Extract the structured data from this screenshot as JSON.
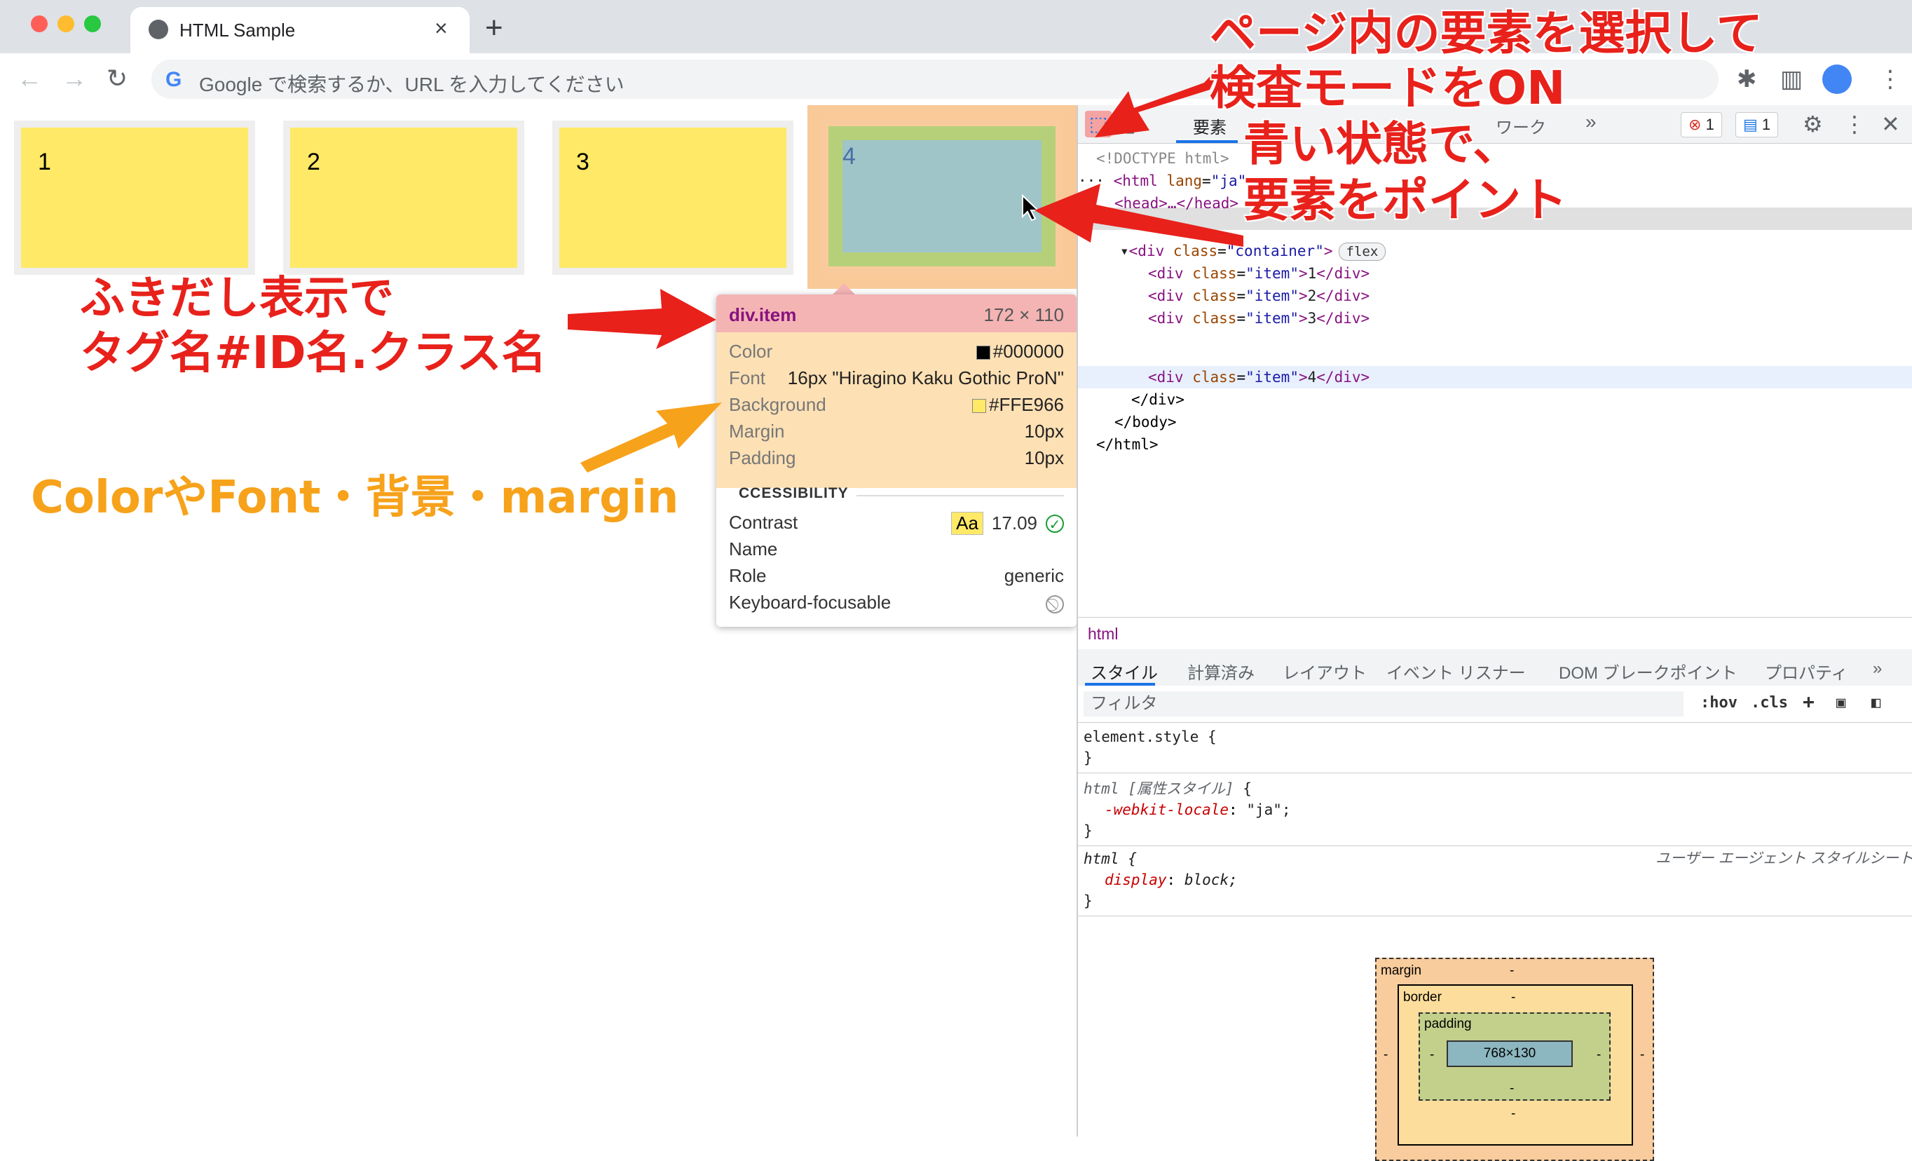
{
  "browser": {
    "tab_title": "HTML Sample",
    "tab_close": "×",
    "new_tab": "+",
    "omnibox_placeholder": "Google で検索するか、URL を入力してください",
    "back": "←",
    "forward": "→",
    "reload": "↻"
  },
  "page": {
    "items": [
      "1",
      "2",
      "3",
      "4"
    ]
  },
  "tooltip": {
    "tag": "div.item",
    "size": "172 × 110",
    "color_label": "Color",
    "color_value": "#000000",
    "font_label": "Font",
    "font_value": "16px \"Hiragino Kaku Gothic ProN\"",
    "background_label": "Background",
    "background_value": "#FFE966",
    "margin_label": "Margin",
    "margin_value": "10px",
    "padding_label": "Padding",
    "padding_value": "10px",
    "accessibility_heading": "CCESSIBILITY",
    "contrast_label": "Contrast",
    "contrast_aa": "Aa",
    "contrast_value": "17.09",
    "name_label": "Name",
    "role_label": "Role",
    "role_value": "generic",
    "keyboard_label": "Keyboard-focusable"
  },
  "devtools": {
    "elements_tab": "要素",
    "network_tab": "ワーク",
    "more_tabs": "»",
    "error_count": "1",
    "message_count": "1",
    "dom": {
      "doctype": "<!DOCTYPE html>",
      "html_open_tag": "<html",
      "html_attr": "lang",
      "html_attr_val": "\"ja\"",
      "html_close_bracket": ">",
      "head": "<head>…</head>",
      "div_open": "<div",
      "container_attr": "class",
      "container_val": "\"container\"",
      "flex_badge": "flex",
      "rows": [
        {
          "open": "<div",
          "attr": "class",
          "val": "\"item\"",
          "text": "1",
          "close": "</div>"
        },
        {
          "open": "<div",
          "attr": "class",
          "val": "\"item\"",
          "text": "2",
          "close": "</div>"
        },
        {
          "open": "<div",
          "attr": "class",
          "val": "\"item\"",
          "text": "3",
          "close": "</div>"
        },
        {
          "open": "<div",
          "attr": "class",
          "val": "\"item\"",
          "text": "4",
          "close": "</div>"
        }
      ],
      "div_close": "</div>",
      "body_close": "</body>",
      "html_close": "</html>"
    },
    "breadcrumb": "html",
    "style_tabs": [
      "スタイル",
      "計算済み",
      "レイアウト",
      "イベント リスナー",
      "DOM ブレークポイント",
      "プロパティ",
      "»"
    ],
    "filter_placeholder": "フィルタ",
    "hov": ":hov",
    "cls": ".cls",
    "styles": {
      "rule1_selector": "element.style {",
      "rule1_close": "}",
      "rule2_selector": "html",
      "rule2_attr": "[属性スタイル]",
      "rule2_brace": "{",
      "rule2_prop": "-webkit-locale",
      "rule2_val": "\"ja\";",
      "rule2_close": "}",
      "rule3_selector": "html {",
      "rule3_source": "ユーザー エージェント スタイルシート",
      "rule3_prop": "display",
      "rule3_val": "block;",
      "rule3_close": "}"
    },
    "box_model": {
      "margin_label": "margin",
      "border_label": "border",
      "padding_label": "padding",
      "content_size": "768×130",
      "dash": "-"
    }
  },
  "annotations": {
    "top_right_1": "ページ内の要素を選択して",
    "top_right_2": "検査モードをON",
    "top_right_3": "青い状態で、",
    "top_right_4": "要素をポイント",
    "left_1": "ふきだし表示で",
    "left_2": "タグ名#ID名.クラス名",
    "orange": "ColorやFont・背景・margin"
  },
  "colors": {
    "item_bg": "#FFE966",
    "annotation_red": "#E8211B",
    "annotation_orange": "#F7A21B",
    "accent_blue": "#1A73E8"
  }
}
